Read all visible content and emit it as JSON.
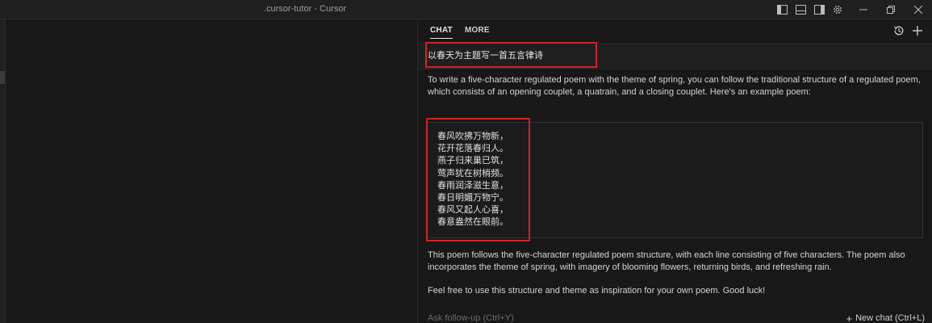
{
  "window": {
    "title": ".cursor-tutor - Cursor",
    "icons": [
      "toggle-primary-sidebar-icon",
      "toggle-panel-icon",
      "toggle-secondary-sidebar-icon",
      "gear-icon"
    ],
    "controls": [
      "minimize-icon",
      "restore-icon",
      "close-icon"
    ]
  },
  "panel": {
    "tabs": [
      {
        "label": "CHAT",
        "active": true
      },
      {
        "label": "MORE",
        "active": false
      }
    ],
    "actions": [
      "history-icon",
      "plus-icon"
    ]
  },
  "chat": {
    "user_message": "以春天为主题写一首五言律诗",
    "reply_intro": "To write a five-character regulated poem with the theme of spring, you can follow the traditional structure of a regulated poem, which consists of an opening couplet, a quatrain, and a closing couplet. Here's an example poem:",
    "poem_lines": [
      "春风吹拂万物新，",
      "花开花落春归人。",
      "燕子归来巢已筑，",
      "莺声犹在树梢频。",
      "春雨润泽滋生意，",
      "春日明媚万物宁。",
      "春风又起人心喜，",
      "春意盎然在眼前。"
    ],
    "reply_explanation": "This poem follows the five-character regulated poem structure, with each line consisting of five characters. The poem also incorporates the theme of spring, with imagery of blooming flowers, returning birds, and refreshing rain.",
    "reply_closing": "Feel free to use this structure and theme as inspiration for your own poem. Good luck!"
  },
  "footer": {
    "followup_placeholder": "Ask follow-up (Ctrl+Y)",
    "new_chat_label": "New chat (Ctrl+L)"
  },
  "colors": {
    "highlight": "#d0232a",
    "background": "#181818"
  }
}
